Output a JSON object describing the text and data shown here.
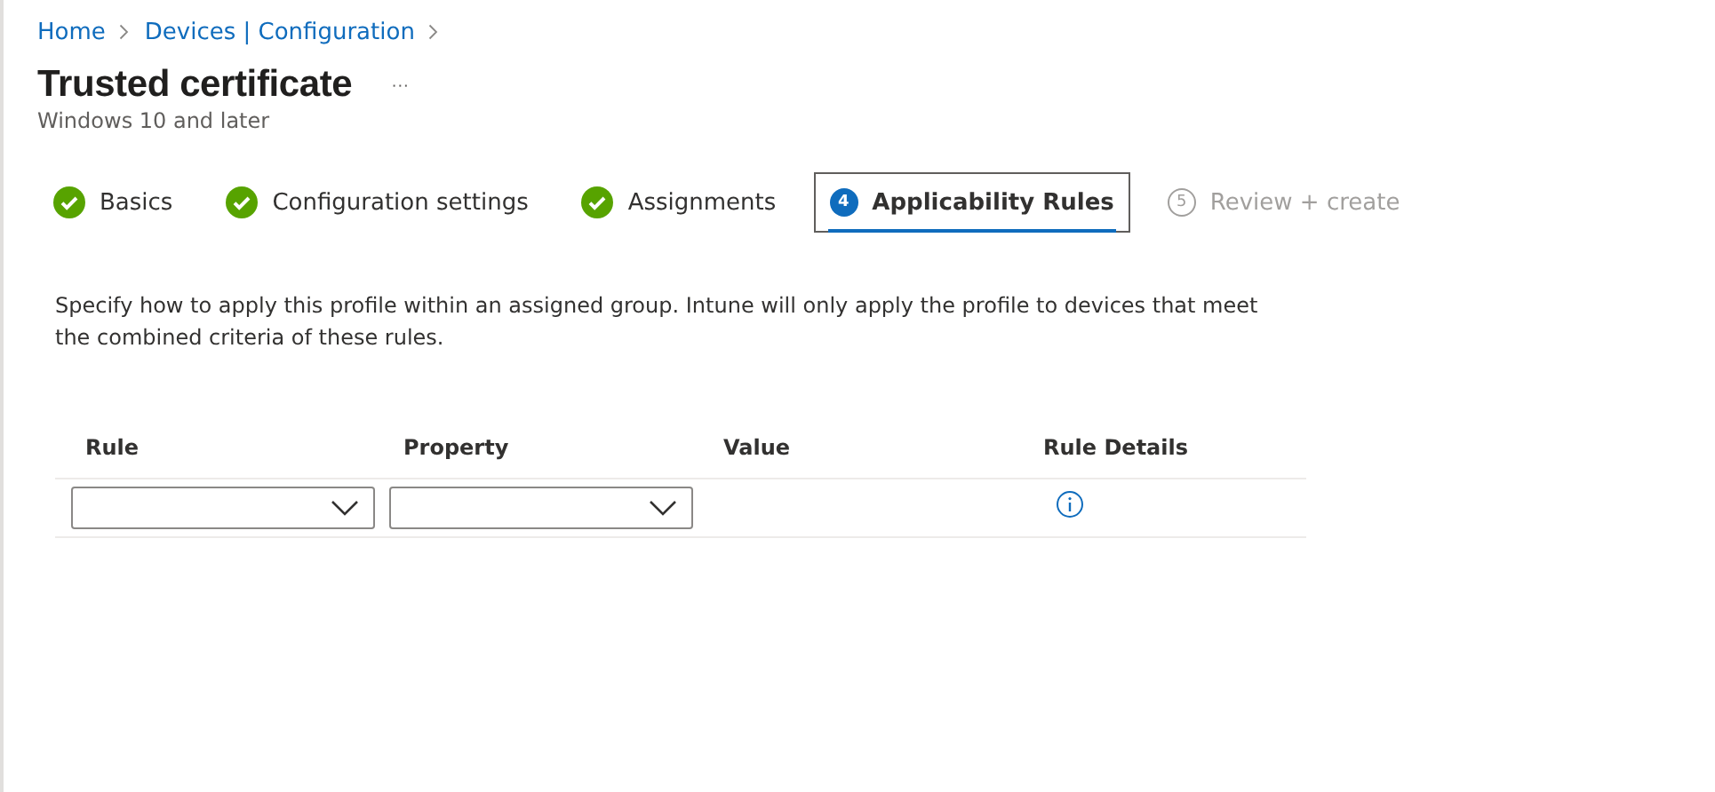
{
  "breadcrumb": [
    "Home",
    "Devices | Configuration"
  ],
  "title": "Trusted certificate",
  "more": "···",
  "subtitle": "Windows 10 and later",
  "steps": [
    {
      "label": "Basics",
      "kind": "done",
      "selected": false
    },
    {
      "label": "Configuration settings",
      "kind": "done",
      "selected": false
    },
    {
      "label": "Assignments",
      "kind": "done",
      "selected": false
    },
    {
      "label": "Applicability Rules",
      "number": "4",
      "kind": "current",
      "selected": true
    },
    {
      "label": "Review + create",
      "number": "5",
      "kind": "upcoming",
      "selected": false
    }
  ],
  "description": "Specify how to apply this profile within an assigned group. Intune will only apply the profile to devices that meet the combined criteria of these rules.",
  "table": {
    "columns": [
      "Rule",
      "Property",
      "Value",
      "Rule Details"
    ],
    "rows": [
      {
        "rule": {
          "kind": "dropdown"
        },
        "property": {
          "kind": "dropdown"
        }
      }
    ]
  }
}
